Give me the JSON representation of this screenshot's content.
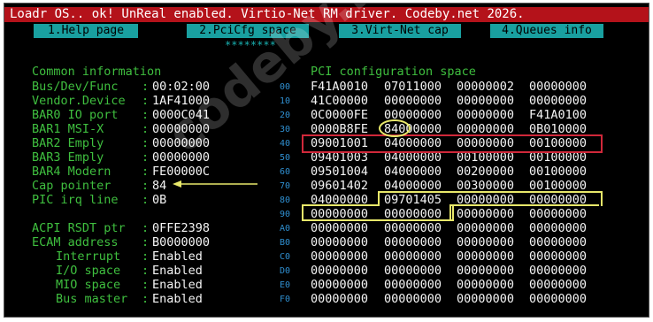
{
  "banner": "Loadr OS.. ok! UnReal enabled. Virtio-Net RM driver. Codeby.net 2026.",
  "tabs": [
    "1.Help page",
    "2.PciCfg space",
    "3.Virt-Net cap",
    "4.Queues info"
  ],
  "active_marker": "********",
  "left_title": "Common information",
  "info": [
    {
      "label": "Bus/Dev/Func",
      "value": "00:02:00"
    },
    {
      "label": "Vendor.Device",
      "value": "1AF41000"
    },
    {
      "label": "BAR0 IO port",
      "value": "0000C041"
    },
    {
      "label": "BAR1 MSI-X",
      "value": "00000000"
    },
    {
      "label": "BAR2 Emply",
      "value": "00000000"
    },
    {
      "label": "BAR3 Emply",
      "value": "00000000"
    },
    {
      "label": "BAR4 Modern",
      "value": "FE00000C"
    },
    {
      "label": "Cap pointer",
      "value": "84"
    },
    {
      "label": "PIC irq line",
      "value": "0B"
    }
  ],
  "info2": [
    {
      "label": "ACPI RSDT ptr",
      "value": "0FFE2398"
    },
    {
      "label": "ECAM address",
      "value": "B0000000"
    }
  ],
  "status": [
    {
      "label": "Interrupt",
      "value": "Enabled"
    },
    {
      "label": "I/O space",
      "value": "Enabled"
    },
    {
      "label": "MIO space",
      "value": "Enabled"
    },
    {
      "label": "Bus master",
      "value": "Enabled"
    }
  ],
  "right_title": "PCI configuration space",
  "pci_rows": [
    {
      "offset": "00",
      "dwords": [
        "F41A0010",
        "07011000",
        "00000002",
        "00000000"
      ]
    },
    {
      "offset": "10",
      "dwords": [
        "41C00000",
        "00000000",
        "00000000",
        "00000000"
      ]
    },
    {
      "offset": "20",
      "dwords": [
        "0C0000FE",
        "00000000",
        "00000000",
        "F41A0100"
      ]
    },
    {
      "offset": "30",
      "dwords": [
        "0000B8FE",
        "84000000",
        "00000000",
        "0B010000"
      ]
    },
    {
      "offset": "40",
      "dwords": [
        "09001001",
        "04000000",
        "00000000",
        "00100000"
      ]
    },
    {
      "offset": "50",
      "dwords": [
        "09401003",
        "04000000",
        "00100000",
        "00100000"
      ]
    },
    {
      "offset": "60",
      "dwords": [
        "09501004",
        "04000000",
        "00200000",
        "00100000"
      ]
    },
    {
      "offset": "70",
      "dwords": [
        "09601402",
        "04000000",
        "00300000",
        "00100000"
      ]
    },
    {
      "offset": "80",
      "dwords": [
        "04000000",
        "09701405",
        "00000000",
        "00000000"
      ]
    },
    {
      "offset": "90",
      "dwords": [
        "00000000",
        "00000000",
        "00000000",
        "00000000"
      ]
    },
    {
      "offset": "A0",
      "dwords": [
        "00000000",
        "00000000",
        "00000000",
        "00000000"
      ]
    },
    {
      "offset": "B0",
      "dwords": [
        "00000000",
        "00000000",
        "00000000",
        "00000000"
      ]
    },
    {
      "offset": "C0",
      "dwords": [
        "00000000",
        "00000000",
        "00000000",
        "00000000"
      ]
    },
    {
      "offset": "D0",
      "dwords": [
        "00000000",
        "00000000",
        "00000000",
        "00000000"
      ]
    },
    {
      "offset": "E0",
      "dwords": [
        "00000000",
        "00000000",
        "00000000",
        "00000000"
      ]
    },
    {
      "offset": "F0",
      "dwords": [
        "00000000",
        "00000000",
        "00000000",
        "00000000"
      ]
    }
  ],
  "watermark": "codeby.net",
  "colors": {
    "banner": "#b4121a",
    "tab": "#19a0a0",
    "label": "#3fbf3f",
    "value": "#f5f5f5",
    "offset": "#2f8fd0",
    "red_box": "#d0283a",
    "yellow_box": "#e8e86a"
  }
}
